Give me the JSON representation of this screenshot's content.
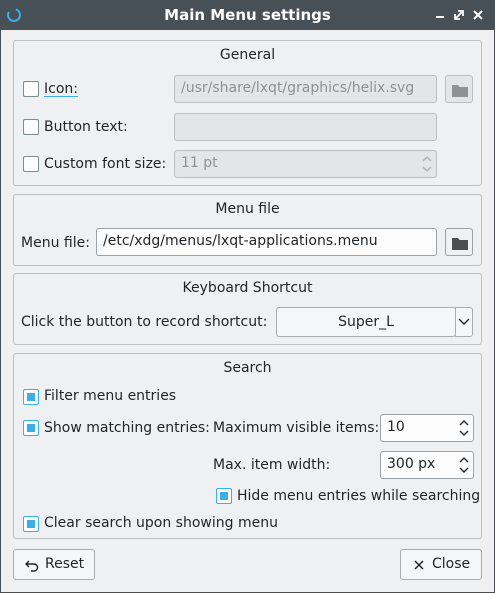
{
  "window": {
    "title": "Main Menu settings"
  },
  "general": {
    "heading": "General",
    "icon_label": "Icon:",
    "icon_path": "/usr/share/lxqt/graphics/helix.svg",
    "button_text_label": "Button text:",
    "button_text_value": "",
    "font_size_label": "Custom font size:",
    "font_size_value": "11 pt"
  },
  "menu_file": {
    "heading": "Menu file",
    "label": "Menu file:",
    "value": "/etc/xdg/menus/lxqt-applications.menu"
  },
  "shortcut": {
    "heading": "Keyboard Shortcut",
    "label": "Click the button to record shortcut:",
    "value": "Super_L"
  },
  "search": {
    "heading": "Search",
    "filter_label": "Filter menu entries",
    "show_matching_label": "Show matching entries:",
    "max_visible_label": "Maximum visible items:",
    "max_visible_value": "10",
    "max_width_label": "Max. item width:",
    "max_width_value": "300 px",
    "hide_entries_label": "Hide menu entries while searching",
    "clear_search_label": "Clear search upon showing menu"
  },
  "buttons": {
    "reset": "Reset",
    "close": "Close"
  },
  "states": {
    "icon_checked": false,
    "button_text_checked": false,
    "font_size_checked": false,
    "filter_checked": true,
    "show_matching_checked": true,
    "hide_entries_checked": true,
    "clear_search_checked": true
  },
  "icons": {
    "app": "lxqt-logo-icon",
    "minimize": "minimize-icon",
    "restore": "restore-icon",
    "close": "close-icon",
    "folder": "folder-icon",
    "reset": "undo-icon",
    "close_button": "x-icon"
  },
  "colors": {
    "titlebar": "#475057",
    "accent": "#3daee9",
    "background": "#eff0f1"
  }
}
